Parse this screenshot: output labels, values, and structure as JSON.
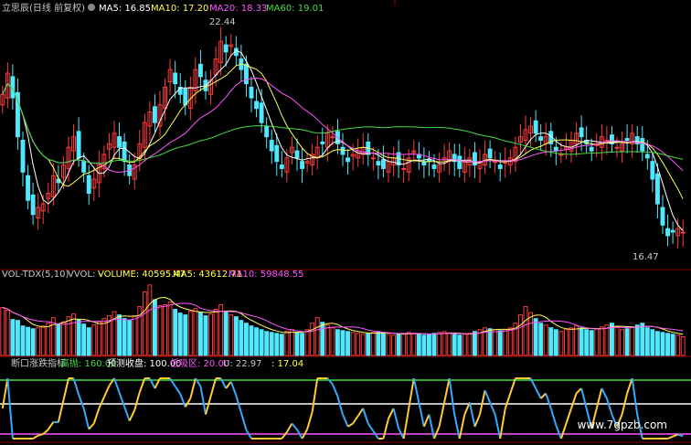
{
  "colors": {
    "up": "#ff3b3b",
    "down": "#4ee8ff",
    "ma5": "#ffffff",
    "ma10": "#ffff55",
    "ma20": "#ff55ff",
    "ma60": "#44dd44",
    "vol_ma5": "#ffff55",
    "vol_ma10": "#ff55ff",
    "grid": "#8b0000",
    "label_white": "#c8c8c8"
  },
  "main_panel": {
    "title": "立思辰(日线 前复权)",
    "ma5_label": "MA5: 16.85",
    "ma10_label": "MA10: 17.20",
    "ma20_label": "MA20: 18.33",
    "ma60_label": "MA60: 19.01",
    "high_marker": "22.44",
    "low_marker": "16.47"
  },
  "volume_panel": {
    "title": "VOL-TDX(5,10)",
    "vvol_label": "VVOL: -",
    "volume_label": "VOLUME: 40595.47",
    "ma5_label": "MA5: 43612.71",
    "ma10_label": "MA10: 59848.55"
  },
  "indicator_panel": {
    "title": "断口涨跌指标",
    "high_label": "高抛: 160.00",
    "forecast_label": "预测收盘: 100.00",
    "low_label": "低吸区: 20.00",
    "u_label": "U: 22.97",
    "last_label": ": 17.04"
  },
  "watermark": "www.7gpzb.com",
  "chart_data": [
    {
      "type": "candlestick",
      "title": "立思辰(日线 前复权)",
      "ylim": [
        16.0,
        22.8
      ],
      "annotations": {
        "high": 22.44,
        "low": 16.47
      },
      "series_labels": [
        "MA5: 16.85",
        "MA10: 17.20",
        "MA20: 18.33",
        "MA60: 19.01"
      ],
      "close": [
        20.7,
        21.3,
        20.6,
        19.5,
        18.5,
        17.7,
        17.3,
        17.5,
        17.6,
        17.9,
        18.4,
        18.2,
        18.7,
        19.2,
        19.5,
        18.9,
        18.5,
        17.9,
        18.3,
        18.7,
        19.0,
        19.3,
        19.6,
        19.2,
        18.8,
        18.4,
        18.7,
        19.3,
        19.9,
        20.2,
        19.9,
        20.4,
        20.9,
        21.4,
        21.0,
        20.7,
        20.4,
        20.9,
        21.4,
        21.2,
        20.8,
        21.1,
        21.7,
        22.2,
        21.9,
        22.1,
        21.8,
        21.4,
        21.0,
        20.6,
        20.3,
        19.9,
        19.5,
        19.1,
        18.8,
        18.6,
        18.9,
        19.2,
        18.9,
        18.6,
        18.8,
        19.0,
        19.2,
        19.3,
        19.6,
        19.5,
        19.3,
        19.0,
        18.8,
        19.0,
        19.1,
        19.2,
        19.0,
        18.9,
        18.7,
        18.6,
        18.8,
        18.9,
        18.7,
        18.6,
        18.9,
        19.1,
        18.9,
        18.7,
        18.8,
        18.6,
        18.7,
        18.9,
        19.1,
        18.8,
        18.6,
        18.8,
        18.9,
        18.7,
        18.8,
        19.0,
        18.9,
        18.8,
        18.6,
        18.8,
        18.9,
        19.2,
        19.5,
        19.7,
        19.8,
        19.6,
        19.4,
        19.5,
        19.3,
        19.1,
        19.0,
        19.2,
        19.4,
        19.6,
        19.5,
        19.3,
        19.1,
        19.3,
        19.5,
        19.4,
        19.3,
        19.2,
        19.3,
        19.4,
        19.6,
        19.3,
        19.1,
        18.9,
        18.3,
        17.6,
        17.0,
        16.7,
        16.8,
        16.9,
        16.8
      ],
      "volume": [
        104000,
        98000,
        78000,
        76000,
        64000,
        61000,
        58000,
        60000,
        64000,
        70000,
        82000,
        68000,
        73000,
        84000,
        90000,
        78000,
        68000,
        60000,
        66000,
        73000,
        80000,
        86000,
        95000,
        88000,
        80000,
        76000,
        86000,
        106000,
        138000,
        153000,
        121000,
        108000,
        110000,
        116000,
        100000,
        92000,
        88000,
        96000,
        102000,
        94000,
        86000,
        90000,
        100000,
        110000,
        96000,
        88000,
        84000,
        76000,
        70000,
        64000,
        60000,
        56000,
        52000,
        50000,
        48000,
        46000,
        52000,
        56000,
        50000,
        48000,
        56000,
        70000,
        82000,
        72000,
        66000,
        60000,
        56000,
        54000,
        52000,
        50000,
        48000,
        46000,
        48000,
        50000,
        52000,
        48000,
        46000,
        44000,
        46000,
        48000,
        50000,
        48000,
        46000,
        44000,
        46000,
        48000,
        50000,
        52000,
        48000,
        46000,
        44000,
        46000,
        48000,
        52000,
        56000,
        60000,
        58000,
        56000,
        54000,
        56000,
        60000,
        70000,
        88000,
        106000,
        93000,
        80000,
        70000,
        66000,
        60000,
        56000,
        52000,
        56000,
        60000,
        64000,
        60000,
        56000,
        54000,
        58000,
        62000,
        66000,
        70000,
        62000,
        56000,
        58000,
        62000,
        66000,
        70000,
        60000,
        56000,
        52000,
        50000,
        48000,
        46000,
        44000,
        40595
      ]
    }
  ]
}
